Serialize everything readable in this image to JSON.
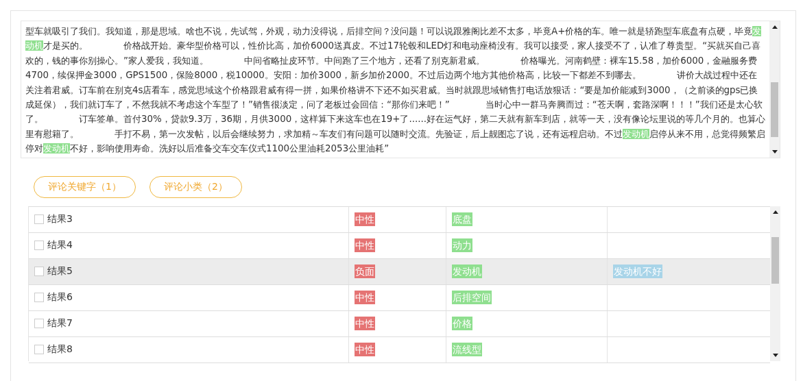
{
  "review_text": {
    "segments": [
      {
        "text": "型车就吸引了我们。我知道，那是思域。啥也不说，先试驾，外观，动力没得说，后排空间？没问题！可以说跟雅阁比差不太多，毕竟A+价格的车。唯一就是轿跑型车底盘有点硬，毕竟",
        "highlighted": false
      },
      {
        "text": "发动机",
        "highlighted": true
      },
      {
        "text": "才是买的。　　　　价格战开始。豪华型价格可以，性价比高，加价6000送真皮。不过17轮毂和LED灯和电动座椅没有。我可以接受，家人接受不了，认准了尊贵型。“买就买自己喜欢的，钱的事你别操心。”家人爱我，我知道。　　　　中间省略扯皮环节。中间跑了三个地方，还看了别克新君威。　　　　价格曝光。河南鹤壁：裸车15.58，加价6000，金融服务费4700，续保押金3000，GPS1500，保险8000，税10000。安阳：加价3000，新乡加价2000。不过后边两个地方其他价格高，比较一下都差不到哪去。　　　　讲价大战过程中还在关注着君威。订车前在别克4s店看车，感觉思域这个价格跟君威有得一拼，如果价格讲不下还不如买君威。当时就跟思域销售打电话放狠话：“要是加价能减到3000，（之前谈的gps已换成延保），我们就订车了，不然我就不考虑这个车型了！”销售很淡定，问了老板过会回信：“那你们来吧！”　　　　当时心中一群马奔腾而过：“苍天啊，套路深啊！！！”我们还是太心软了。　　　　订车签单。首付30%，贷款9.3万，36期，月供3000，这样算下来这车也在19+了......好在运气好，第二天就有新车到店，就等一天，没有像论坛里说的等几个月的。也算心里有慰籍了。　　　　手打不易，第一次发帖，以后会继续努力，求加精～车友们有问题可以随时交流。先验证，后上靓图忘了说，还有远程启动。不过",
        "highlighted": false
      },
      {
        "text": "发动机",
        "highlighted": true
      },
      {
        "text": "启停从来不用，总觉得频繁启停对",
        "highlighted": false
      },
      {
        "text": "发动机",
        "highlighted": true
      },
      {
        "text": "不好，影响使用寿命。洗好以后准备交车交车仪式1100公里油耗2053公里油耗”",
        "highlighted": false
      }
    ]
  },
  "tabs": [
    {
      "label": "评论关键字（1）",
      "selected": false
    },
    {
      "label": "评论小类（2）",
      "selected": false
    }
  ],
  "results": [
    {
      "name": "结果3",
      "checked": false,
      "selected": false,
      "sentiment": "中性",
      "color": "#e57373",
      "keyword": "底盘"
    },
    {
      "name": "结果4",
      "checked": false,
      "selected": false,
      "sentiment": "中性",
      "color": "#e57373",
      "keyword": "动力"
    },
    {
      "name": "结果5",
      "checked": false,
      "selected": true,
      "sentiment": "负面",
      "color": "#e57373",
      "keyword": "发动机",
      "opinion": "发动机不好"
    },
    {
      "name": "结果6",
      "checked": false,
      "selected": false,
      "sentiment": "中性",
      "color": "#e57373",
      "keyword": "后排空间"
    },
    {
      "name": "结果7",
      "checked": false,
      "selected": false,
      "sentiment": "中性",
      "color": "#e57373",
      "keyword": "价格"
    },
    {
      "name": "结果8",
      "checked": false,
      "selected": false,
      "sentiment": "中性",
      "color": "#e57373",
      "keyword": "流线型"
    }
  ]
}
